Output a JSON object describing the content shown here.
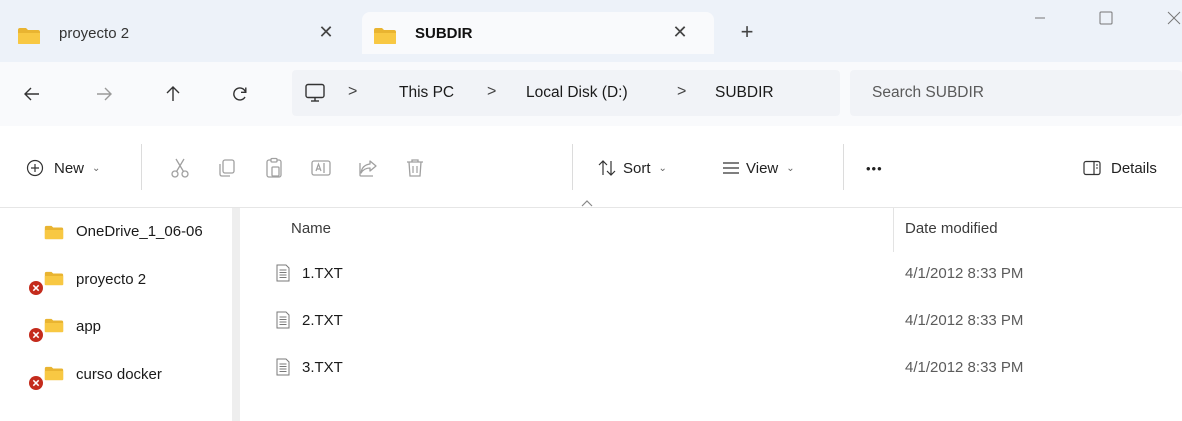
{
  "tabs": [
    {
      "label": "proyecto 2",
      "active": false
    },
    {
      "label": "SUBDIR",
      "active": true
    }
  ],
  "new_tab_label": "+",
  "address": {
    "crumbs": [
      "This PC",
      "Local Disk (D:)",
      "SUBDIR"
    ],
    "separator": ">"
  },
  "search": {
    "placeholder": "Search SUBDIR"
  },
  "toolbar": {
    "new_label": "New",
    "sort_label": "Sort",
    "view_label": "View",
    "more_label": "•••",
    "details_label": "Details"
  },
  "sidebar": {
    "items": [
      {
        "label": "OneDrive_1_06-06",
        "error": false
      },
      {
        "label": "proyecto 2",
        "error": true
      },
      {
        "label": "app",
        "error": true
      },
      {
        "label": "curso docker",
        "error": true
      }
    ]
  },
  "columns": {
    "name": "Name",
    "date": "Date modified"
  },
  "files": [
    {
      "name": "1.TXT",
      "date": "4/1/2012 8:33 PM"
    },
    {
      "name": "2.TXT",
      "date": "4/1/2012 8:33 PM"
    },
    {
      "name": "3.TXT",
      "date": "4/1/2012 8:33 PM"
    }
  ],
  "colors": {
    "folder": "#f6c342",
    "error_badge": "#c42b1c",
    "titlebar": "#edf2f9"
  }
}
